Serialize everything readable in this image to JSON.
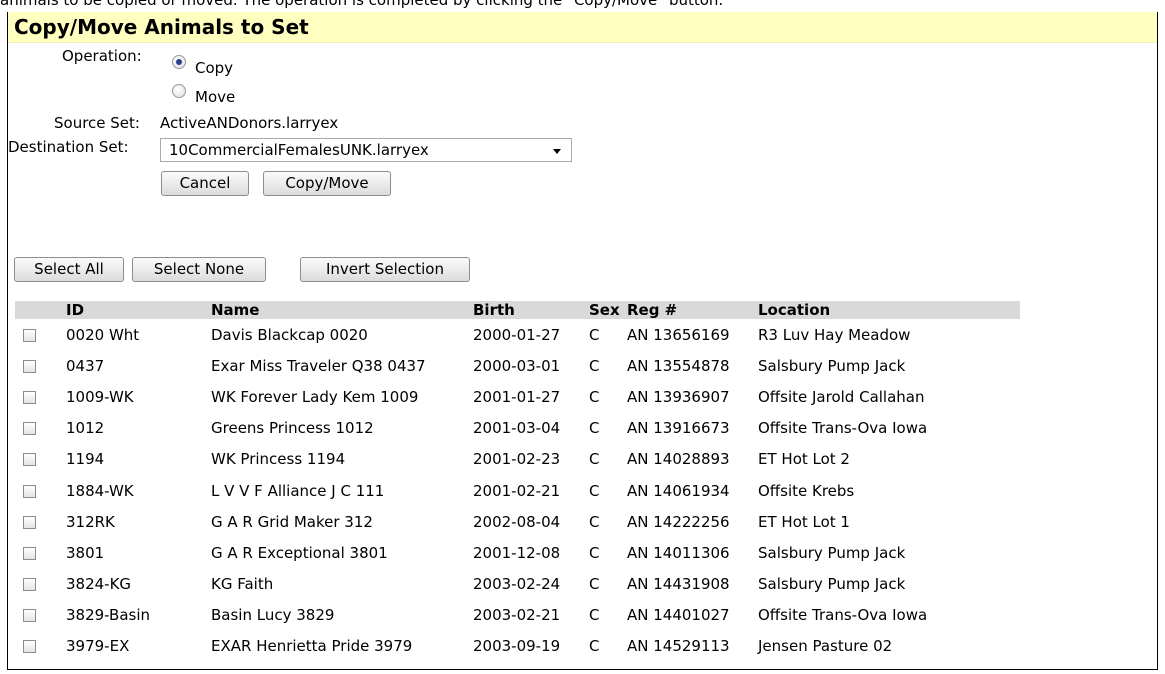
{
  "caption": "animals to be copied or moved.  The operation is completed by clicking the \"Copy/Move\" button.",
  "panel": {
    "title": "Copy/Move Animals to Set"
  },
  "form": {
    "operation_label": "Operation:",
    "options": [
      {
        "label": "Copy",
        "checked": true
      },
      {
        "label": "Move",
        "checked": false
      }
    ],
    "source_label": "Source Set:",
    "source_value": "ActiveANDonors.larryex",
    "destination_label": "Destination Set:",
    "destination_value": "10CommercialFemalesUNK.larryex",
    "cancel_label": "Cancel",
    "copymove_label": "Copy/Move"
  },
  "selection": {
    "select_all": "Select All",
    "select_none": "Select None",
    "invert": "Invert Selection"
  },
  "table": {
    "headers": [
      "ID",
      "Name",
      "Birth",
      "Sex",
      "Reg #",
      "Location"
    ],
    "rows": [
      {
        "id": "0020 Wht",
        "name": "Davis Blackcap 0020",
        "birth": "2000-01-27",
        "sex": "C",
        "reg": "AN 13656169",
        "location": "R3 Luv Hay Meadow"
      },
      {
        "id": "0437",
        "name": "Exar Miss Traveler Q38 0437",
        "birth": "2000-03-01",
        "sex": "C",
        "reg": "AN 13554878",
        "location": "Salsbury Pump Jack"
      },
      {
        "id": "1009-WK",
        "name": "WK Forever Lady Kem 1009",
        "birth": "2001-01-27",
        "sex": "C",
        "reg": "AN 13936907",
        "location": "Offsite Jarold Callahan"
      },
      {
        "id": "1012",
        "name": "Greens Princess 1012",
        "birth": "2001-03-04",
        "sex": "C",
        "reg": "AN 13916673",
        "location": "Offsite Trans-Ova Iowa"
      },
      {
        "id": "1194",
        "name": "WK Princess 1194",
        "birth": "2001-02-23",
        "sex": "C",
        "reg": "AN 14028893",
        "location": "ET Hot Lot 2"
      },
      {
        "id": "1884-WK",
        "name": "L V V F Alliance J C 111",
        "birth": "2001-02-21",
        "sex": "C",
        "reg": "AN 14061934",
        "location": "Offsite Krebs"
      },
      {
        "id": "312RK",
        "name": "G A R Grid Maker 312",
        "birth": "2002-08-04",
        "sex": "C",
        "reg": "AN 14222256",
        "location": "ET Hot Lot 1"
      },
      {
        "id": "3801",
        "name": "G A R Exceptional 3801",
        "birth": "2001-12-08",
        "sex": "C",
        "reg": "AN 14011306",
        "location": "Salsbury Pump Jack"
      },
      {
        "id": "3824-KG",
        "name": "KG Faith",
        "birth": "2003-02-24",
        "sex": "C",
        "reg": "AN 14431908",
        "location": "Salsbury Pump Jack"
      },
      {
        "id": "3829-Basin",
        "name": "Basin Lucy 3829",
        "birth": "2003-02-21",
        "sex": "C",
        "reg": "AN 14401027",
        "location": "Offsite Trans-Ova Iowa"
      },
      {
        "id": "3979-EX",
        "name": "EXAR Henrietta Pride 3979",
        "birth": "2003-09-19",
        "sex": "C",
        "reg": "AN 14529113",
        "location": "Jensen Pasture 02"
      }
    ]
  }
}
